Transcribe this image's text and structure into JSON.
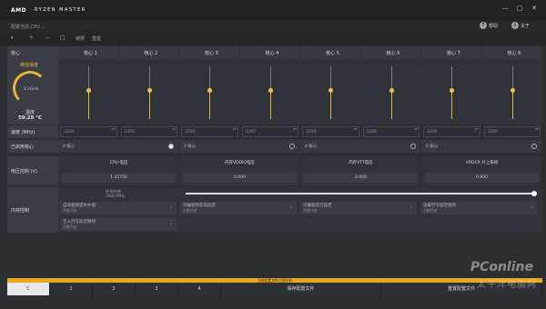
{
  "app": {
    "brand": "AMD",
    "product": "RYZEN MASTER"
  },
  "toolbar": {
    "profile_label": "配置当前 CPU …",
    "help": "帮助",
    "about": "关于",
    "items": [
      "›",
      "+",
      "—",
      "□",
      "缓慢",
      "重置"
    ]
  },
  "window": {
    "minimize": "—",
    "maximize": "□",
    "close": "✕",
    "help_icon": "?",
    "info_icon": "i"
  },
  "cores": {
    "header_label": "核心",
    "names": [
      "核心 1",
      "核心 2",
      "核心 3",
      "核心 4",
      "核心 5",
      "核心 6",
      "核心 7",
      "核心 8"
    ],
    "slider_levels": [
      0.55,
      0.55,
      0.55,
      0.55,
      0.55,
      0.55,
      0.55,
      0.55
    ]
  },
  "gauge": {
    "title": "峰值速度",
    "value": "3.2GHz",
    "temp_label": "温度",
    "temp_value": "59.25 °C"
  },
  "voltage": {
    "label": "速度 (MHz)",
    "values": [
      "3200",
      "3200",
      "3200",
      "3200",
      "3200",
      "3200",
      "3200",
      "3200"
    ]
  },
  "enabled": {
    "label": "已启用核心",
    "values": [
      "8 核心",
      "2 核心",
      "4 核心",
      "6 核心"
    ]
  },
  "power": {
    "label": "电压控制 (V)",
    "names": [
      "CPU 电压",
      "内存VDDIO电压",
      "内存VTT电压",
      "VDDCR 片上系统"
    ],
    "values": [
      "1.35750",
      "0.000",
      "0.000",
      "0.900"
    ]
  },
  "memory": {
    "label": "内存控制",
    "clock_label": "内存时钟",
    "clock_value": "1600 MHz",
    "combos": [
      {
        "title": "自动超频遗失补偿",
        "sub": "主能开启"
      },
      {
        "title": "可编程预充电延迟",
        "sub": "主能开启"
      },
      {
        "title": "可编程读写延迟",
        "sub": "主能开启"
      },
      {
        "title": "读取行写延迟保持",
        "sub": "主能开启"
      },
      {
        "title": "写入行写延迟保持",
        "sub": "主能开启"
      }
    ]
  },
  "profiles": {
    "banner": "当前配置文件已经开启",
    "tabs": [
      "C",
      "1",
      "2",
      "3",
      "4"
    ],
    "save": "保存配置文件",
    "reset": "重置配置文件"
  },
  "watermark": {
    "brand": "PConline",
    "sub": "太平洋电脑网"
  }
}
